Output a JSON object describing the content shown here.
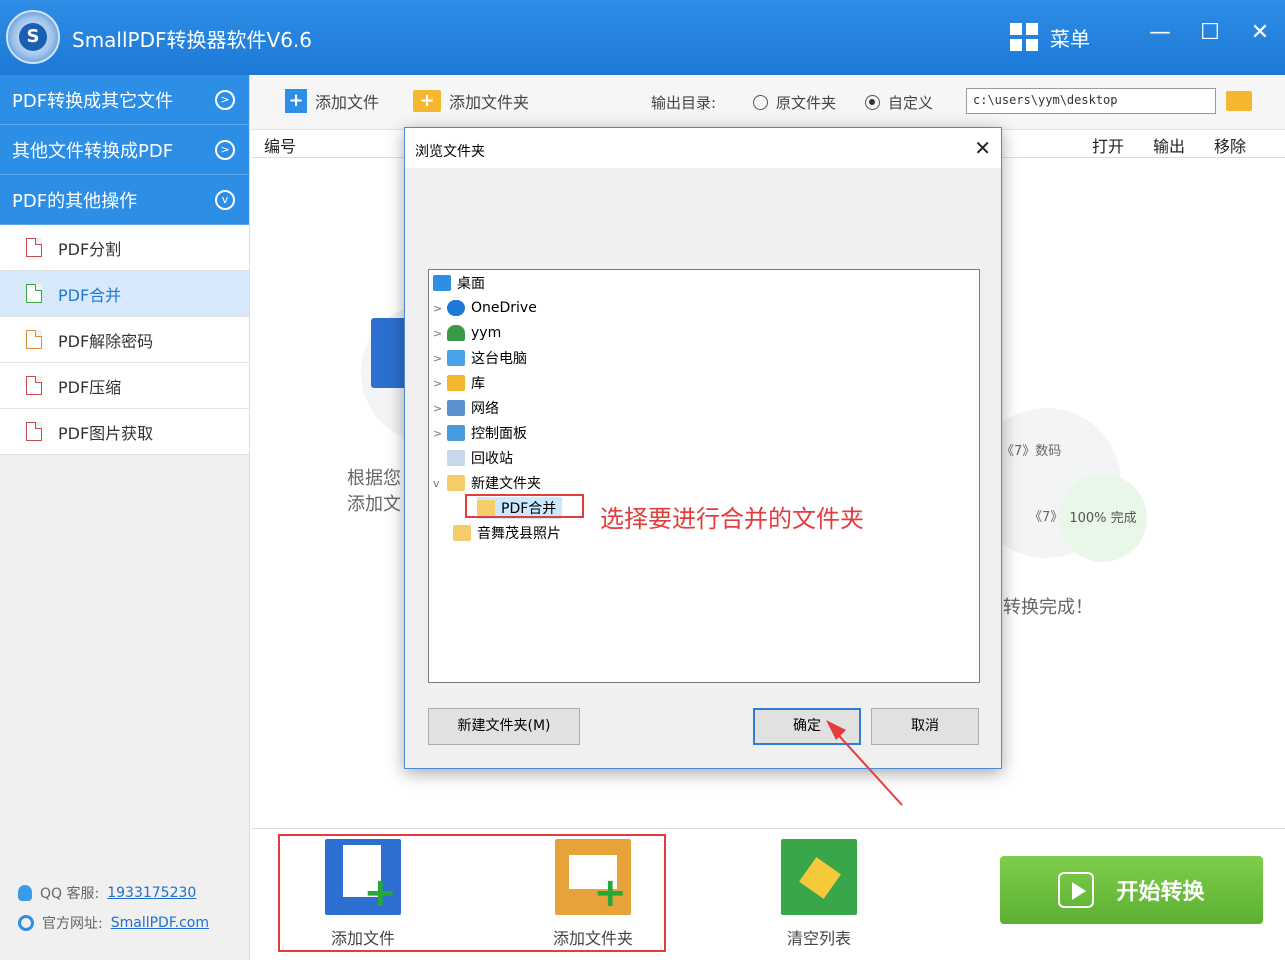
{
  "app": {
    "title": "SmallPDF转换器软件V6.6",
    "menu_label": "菜单",
    "logo_letter": "S"
  },
  "window_controls": {
    "minimize": "—",
    "maximize": "☐",
    "close": "✕"
  },
  "sidebar": {
    "categories": [
      {
        "label": "PDF转换成其它文件",
        "icon": "chevron-right-circle-icon"
      },
      {
        "label": "其他文件转换成PDF",
        "icon": "chevron-right-circle-icon"
      },
      {
        "label": "PDF的其他操作",
        "icon": "chevron-down-circle-icon"
      }
    ],
    "items": [
      {
        "label": "PDF分割"
      },
      {
        "label": "PDF合并",
        "active": true
      },
      {
        "label": "PDF解除密码"
      },
      {
        "label": "PDF压缩"
      },
      {
        "label": "PDF图片获取"
      }
    ],
    "contact": {
      "qq_label": "QQ 客服:",
      "qq_number": "1933175230",
      "site_label": "官方网址:",
      "site_url": "SmallPDF.com"
    }
  },
  "toolbar": {
    "add_file": "添加文件",
    "add_folder": "添加文件夹",
    "output_dir_label": "输出目录:",
    "radio_original": "原文件夹",
    "radio_custom": "自定义",
    "selected_radio": "自定义",
    "path_value": "c:\\users\\yym\\desktop"
  },
  "list_header": {
    "number": "编号",
    "open": "打开",
    "output": "输出",
    "remove": "移除"
  },
  "empty_state": {
    "left_line1": "根据您",
    "left_line2": "添加文",
    "right_row1": "《7》数码",
    "right_row2": "《7》",
    "progress": "100%  完成",
    "right_caption": "转换完成！"
  },
  "bottom_bar": {
    "add_file": "添加文件",
    "add_folder": "添加文件夹",
    "clear_list": "清空列表",
    "start": "开始转换"
  },
  "dialog": {
    "title": "浏览文件夹",
    "close": "✕",
    "tree": [
      {
        "label": "桌面",
        "level": 0,
        "icon": "desktop-icon",
        "chevron": ""
      },
      {
        "label": "OneDrive",
        "level": 1,
        "icon": "cloud-icon",
        "chevron": ">"
      },
      {
        "label": "yym",
        "level": 1,
        "icon": "user-icon",
        "chevron": ">"
      },
      {
        "label": "这台电脑",
        "level": 1,
        "icon": "computer-icon",
        "chevron": ">"
      },
      {
        "label": "库",
        "level": 1,
        "icon": "library-icon",
        "chevron": ">"
      },
      {
        "label": "网络",
        "level": 1,
        "icon": "network-icon",
        "chevron": ">"
      },
      {
        "label": "控制面板",
        "level": 1,
        "icon": "control-panel-icon",
        "chevron": ">"
      },
      {
        "label": "回收站",
        "level": 1,
        "icon": "recycle-bin-icon",
        "chevron": ""
      },
      {
        "label": "新建文件夹",
        "level": 1,
        "icon": "folder-icon",
        "chevron": "v"
      },
      {
        "label": "PDF合并",
        "level": 2,
        "icon": "folder-icon",
        "chevron": "",
        "selected": true
      },
      {
        "label": "音舞茂县照片",
        "level": 1,
        "icon": "folder-icon",
        "chevron": ""
      }
    ],
    "annotation": "选择要进行合并的文件夹",
    "new_folder_button": "新建文件夹(M)",
    "ok_button": "确定",
    "cancel_button": "取消"
  },
  "colors": {
    "brand_blue": "#2d8ee6",
    "annotation_red": "#e43c3c",
    "start_green": "#6cbf3c"
  }
}
